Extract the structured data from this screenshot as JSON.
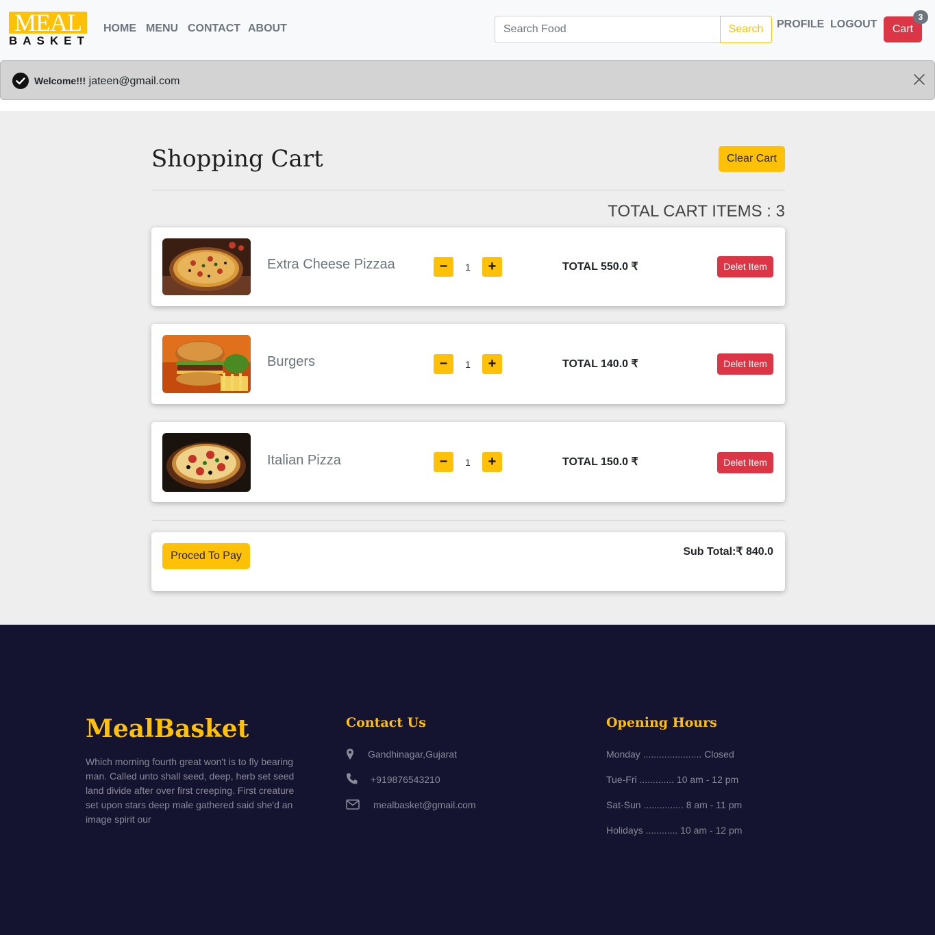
{
  "navbar": {
    "logo_top": "MEAL",
    "logo_bottom": "BASKET",
    "links": [
      "HOME",
      "MENU",
      "CONTACT",
      "ABOUT"
    ],
    "search_placeholder": "Search Food",
    "search_button": "Search",
    "profile": "PROFILE",
    "logout": "LOGOUT",
    "cart_label": "Cart",
    "cart_count": "3"
  },
  "alert": {
    "strong": "Welcome!!!",
    "email": "jateen@gmail.com"
  },
  "cart": {
    "title": "Shopping Cart",
    "clear_button": "Clear Cart",
    "total_items_label": "TOTAL CART ITEMS : 3",
    "items": [
      {
        "name": "Extra Cheese Pizzaa",
        "qty": "1",
        "total": "TOTAL 550.0 ₹",
        "delete": "Delet Item",
        "image": "pizza-image"
      },
      {
        "name": "Burgers",
        "qty": "1",
        "total": "TOTAL 140.0 ₹",
        "delete": "Delet Item",
        "image": "burger-image"
      },
      {
        "name": "Italian Pizza",
        "qty": "1",
        "total": "TOTAL 150.0 ₹",
        "delete": "Delet Item",
        "image": "pizza-image"
      }
    ],
    "pay_button": "Proced To Pay",
    "subtotal": "Sub Total:₹ 840.0"
  },
  "footer": {
    "brand": "MealBasket",
    "description": "Which morning fourth great won't is to fly bearing man. Called unto shall seed, deep, herb set seed land divide after over first creeping. First creature set upon stars deep male gathered said she'd an image spirit our",
    "contact_title": "Contact Us",
    "contact": {
      "address": "Gandhinagar,Gujarat",
      "phone": "+919876543210",
      "email": "mealbasket@gmail.com"
    },
    "hours_title": "Opening Hours",
    "hours": [
      "Monday ...................... Closed",
      "Tue-Fri ............. 10 am - 12 pm",
      "Sat-Sun ............... 8 am - 11 pm",
      "Holidays ............ 10 am - 12 pm"
    ]
  },
  "colors": {
    "accent": "#ffc107",
    "danger": "#dc3545",
    "footer_bg": "#141330",
    "main_bg": "#eeeeee"
  }
}
